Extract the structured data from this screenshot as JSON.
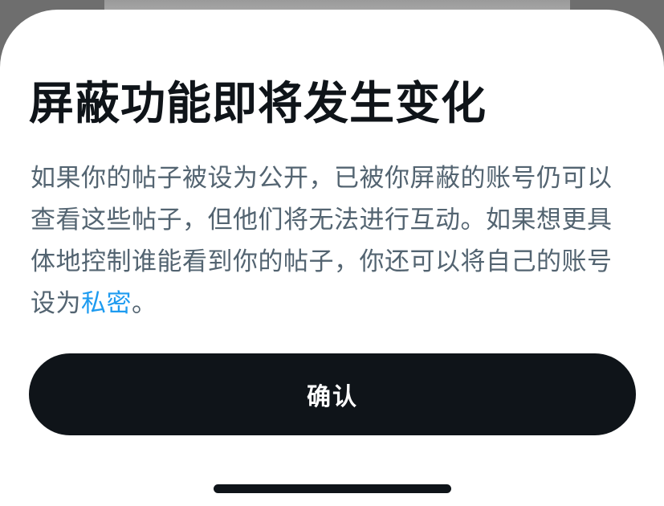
{
  "dialog": {
    "title": "屏蔽功能即将发生变化",
    "body_before_link": "如果你的帖子被设为公开，已被你屏蔽的账号仍可以查看这些帖子，但他们将无法进行互动。如果想更具体地控制谁能看到你的帖子，你还可以将自己的账号设为",
    "link_text": "私密",
    "body_after_link": "。",
    "confirm_label": "确认"
  },
  "colors": {
    "title": "#0f1419",
    "body": "#536471",
    "link": "#1d9bf0",
    "button_bg": "#0f1419",
    "button_text": "#ffffff"
  }
}
